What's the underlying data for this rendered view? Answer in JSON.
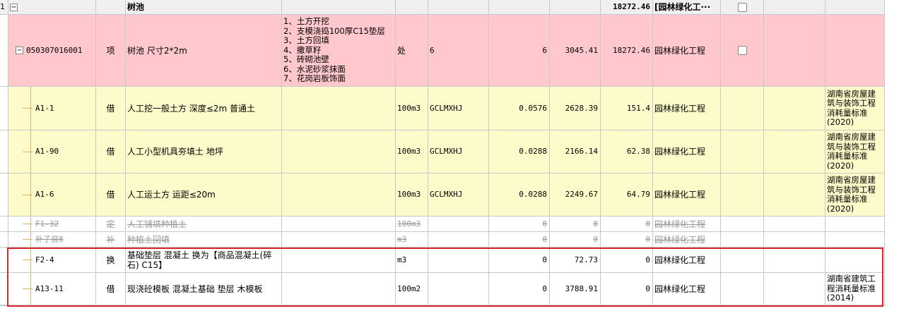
{
  "header_row": {
    "index": "1",
    "name": "树池",
    "amount": "18272.46",
    "category": "[园林绿化工···"
  },
  "rows": [
    {
      "code": "050307016001",
      "type": "项",
      "name": "树池 尺寸2*2m",
      "feature": "1、土方开挖\n2、支模浇捣100厚C15垫层\n3、土方回填\n4、撒草籽\n5、砖砌池壁\n6、水泥砂浆抹面\n7、花岗岩板饰面",
      "unit": "处",
      "expr": "6",
      "qty": "6",
      "price": "3045.41",
      "total": "18272.46",
      "category": "园林绿化工程",
      "note": ""
    },
    {
      "code": "A1-1",
      "type": "借",
      "name": "人工挖一般土方 深度≤2m 普通土",
      "feature": "",
      "unit": "100m3",
      "expr": "GCLMXHJ",
      "qty": "0.0576",
      "price": "2628.39",
      "total": "151.4",
      "category": "园林绿化工程",
      "note": "湖南省房屋建\n筑与装饰工程\n消耗量标准\n(2020)"
    },
    {
      "code": "A1-90",
      "type": "借",
      "name": "人工小型机具夯填土 地坪",
      "feature": "",
      "unit": "100m3",
      "expr": "GCLMXHJ",
      "qty": "0.0288",
      "price": "2166.14",
      "total": "62.38",
      "category": "园林绿化工程",
      "note": "湖南省房屋建\n筑与装饰工程\n消耗量标准\n(2020)"
    },
    {
      "code": "A1-6",
      "type": "借",
      "name": "人工运土方 运距≤20m",
      "feature": "",
      "unit": "100m3",
      "expr": "GCLMXHJ",
      "qty": "0.0288",
      "price": "2249.67",
      "total": "64.79",
      "category": "园林绿化工程",
      "note": "湖南省房屋建\n筑与装饰工程\n消耗量标准\n(2020)"
    },
    {
      "code": "F1-32",
      "type": "定",
      "name": "人工铺填种植土",
      "feature": "",
      "unit": "100m3",
      "expr": "",
      "qty": "0",
      "price": "0",
      "total": "0",
      "category": "园林绿化工程",
      "note": ""
    },
    {
      "code": "补子目8",
      "type": "补",
      "name": "种植土回填",
      "feature": "",
      "unit": "m3",
      "expr": "",
      "qty": "0",
      "price": "0",
      "total": "0",
      "category": "园林绿化工程",
      "note": ""
    },
    {
      "code": "F2-4",
      "type": "换",
      "name": "基础垫层 混凝土  换为【商品混凝土(碎\n石) C15】",
      "feature": "",
      "unit": "m3",
      "expr": "",
      "qty": "0",
      "price": "72.73",
      "total": "0",
      "category": "园林绿化工程",
      "note": ""
    },
    {
      "code": "A13-11",
      "type": "借",
      "name": "现浇砼模板 混凝土基础 垫层 木模板",
      "feature": "",
      "unit": "100m2",
      "expr": "",
      "qty": "0",
      "price": "3788.91",
      "total": "0",
      "category": "园林绿化工程",
      "note": "湖南省建筑工\n程消耗量标准\n(2014)"
    }
  ],
  "colors": {
    "pink": "#ffc8cd",
    "yellow": "#fdfbc9",
    "selection": "#e0262b"
  }
}
